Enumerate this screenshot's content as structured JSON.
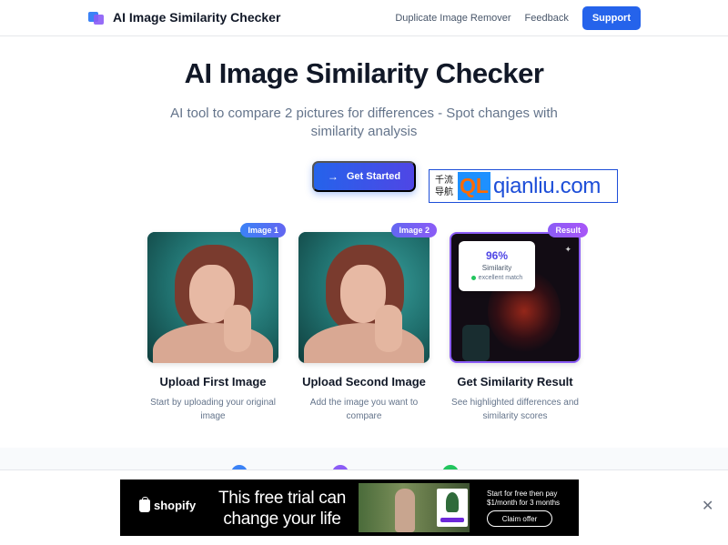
{
  "header": {
    "title": "AI Image Similarity Checker",
    "nav": [
      "Duplicate Image Remover",
      "Feedback"
    ],
    "support_label": "Support"
  },
  "hero": {
    "title": "AI Image Similarity Checker",
    "subtitle": "AI tool to compare 2 pictures for differences - Spot changes with similarity analysis",
    "cta_label": "Get Started",
    "cta_icon": "→"
  },
  "watermark": {
    "cn": "千流导航",
    "ql": "QL",
    "url": "qianliu.com"
  },
  "steps": [
    {
      "badge": "Image 1",
      "title": "Upload First Image",
      "desc": "Start by uploading your original image"
    },
    {
      "badge": "Image 2",
      "title": "Upload Second Image",
      "desc": "Add the image you want to compare"
    },
    {
      "badge": "Result",
      "title": "Get Similarity Result",
      "desc": "See highlighted differences and similarity scores"
    }
  ],
  "result_card": {
    "percent": "96%",
    "label": "Similarity",
    "match": "excellent match"
  },
  "colors": {
    "primary": "#2563eb",
    "badge1": "#3b82f6",
    "badge2": "#6366f1",
    "badge3": "#8b5cf6",
    "dot_blue": "#3b82f6",
    "dot_purple": "#8b5cf6",
    "dot_green": "#22c55e"
  },
  "ad": {
    "brand": "shopify",
    "headline": "This free trial can change your life",
    "copy": "Start for free then pay $1/month for 3 months",
    "claim_label": "Claim offer",
    "close": "✕"
  }
}
